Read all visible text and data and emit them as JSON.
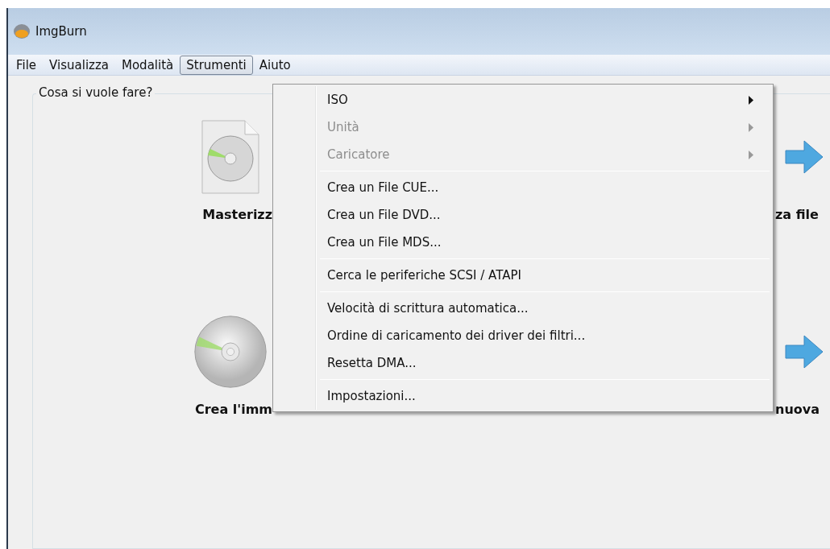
{
  "window": {
    "title": "ImgBurn"
  },
  "menu_bar": [
    {
      "label": "File",
      "selected": false
    },
    {
      "label": "Visualizza",
      "selected": false
    },
    {
      "label": "Modalità",
      "selected": false
    },
    {
      "label": "Strumenti",
      "selected": true
    },
    {
      "label": "Aiuto",
      "selected": false
    }
  ],
  "group": {
    "title": "Cosa si vuole fare?"
  },
  "tasks": [
    {
      "kind": "file-disc",
      "left_label": "Masterizz",
      "right_label": "za file"
    },
    {
      "kind": "disc",
      "left_label": "Crea l'imm",
      "right_label": "nuova"
    }
  ],
  "dropdown": {
    "sections": [
      [
        {
          "label": "ISO",
          "submenu": true,
          "disabled": false
        },
        {
          "label": "Unità",
          "submenu": true,
          "disabled": true
        },
        {
          "label": "Caricatore",
          "submenu": true,
          "disabled": true
        }
      ],
      [
        {
          "label": "Crea un File CUE...",
          "submenu": false,
          "disabled": false
        },
        {
          "label": "Crea un File DVD...",
          "submenu": false,
          "disabled": false
        },
        {
          "label": "Crea un File MDS...",
          "submenu": false,
          "disabled": false
        }
      ],
      [
        {
          "label": "Cerca le periferiche SCSI / ATAPI",
          "submenu": false,
          "disabled": false
        }
      ],
      [
        {
          "label": "Velocità di scrittura automatica...",
          "submenu": false,
          "disabled": false
        },
        {
          "label": "Ordine di caricamento dei driver dei filtri...",
          "submenu": false,
          "disabled": false
        },
        {
          "label": "Resetta DMA...",
          "submenu": false,
          "disabled": false
        }
      ],
      [
        {
          "label": "Impostazioni...",
          "submenu": false,
          "disabled": false
        }
      ]
    ]
  }
}
